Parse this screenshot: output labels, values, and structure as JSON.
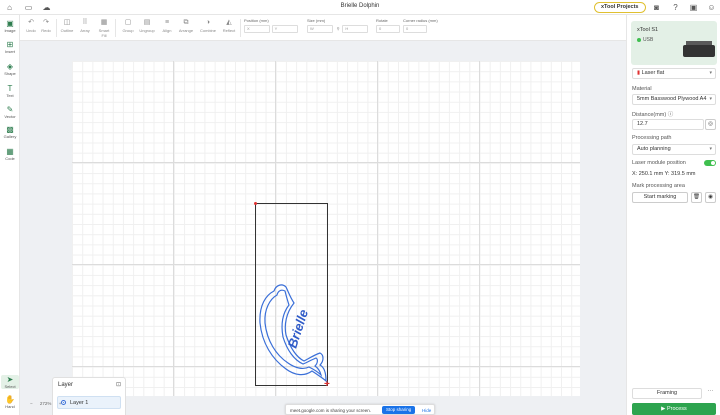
{
  "app": {
    "title": "Brielle Dolphin",
    "notification_badge": ""
  },
  "header": {
    "projects_label": "xTool Projects"
  },
  "toolbar": {
    "undo": "Undo",
    "redo": "Redo",
    "outline": "Outline",
    "array": "Array",
    "smart_fill": "Smart Fill",
    "group": "Group",
    "ungroup": "Ungroup",
    "align": "Align",
    "arrange": "Arrange",
    "combine": "Combine",
    "reflect": "Reflect",
    "position_label": "Position (mm)",
    "pos_x": "X",
    "pos_y": "Y",
    "size_label": "Size (mm)",
    "size_w": "W",
    "size_h": "H",
    "rotate_label": "Rotate",
    "rotate_value": "0",
    "corner_label": "Corner radius (mm)",
    "corner_value": "0"
  },
  "sidebar": {
    "items": [
      {
        "label": "Image",
        "icon": "image-icon"
      },
      {
        "label": "Insert",
        "icon": "insert-icon"
      },
      {
        "label": "Shape",
        "icon": "shape-icon"
      },
      {
        "label": "Text",
        "icon": "text-icon"
      },
      {
        "label": "Vector",
        "icon": "pen-icon"
      },
      {
        "label": "Gallery",
        "icon": "gallery-icon"
      },
      {
        "label": "Code",
        "icon": "qr-icon"
      }
    ],
    "bottom": [
      {
        "label": "Select",
        "icon": "cursor-icon"
      },
      {
        "label": "Hand",
        "icon": "hand-icon"
      }
    ]
  },
  "canvas": {
    "design_text": "Brielle"
  },
  "layer_panel": {
    "title": "Layer",
    "layers": [
      "Layer 1"
    ]
  },
  "zoom": {
    "minus": "−",
    "value": "272%",
    "plus": "+"
  },
  "share_bar": {
    "message": "meet.google.com is sharing your screen.",
    "stop": "Stop sharing",
    "hide": "Hide"
  },
  "right_panel": {
    "device_name": "xTool S1",
    "connection": "USB",
    "laser_mode": "Laser flat",
    "material_label": "Material",
    "material_value": "5mm Basswood Plywood A4",
    "distance_label": "Distance(mm)",
    "distance_value": "12.7",
    "processing_path_label": "Processing path",
    "processing_path_value": "Auto planning",
    "laser_module_label": "Laser module position",
    "laser_position": "X: 250.1 mm  Y: 319.5 mm",
    "mark_area_label": "Mark processing area",
    "start_marking": "Start marking",
    "framing": "Framing",
    "process": "Process"
  },
  "colors": {
    "accent": "#2ea44f",
    "selection": "#e03030",
    "dolphin_stroke": "#3a6fd8"
  }
}
